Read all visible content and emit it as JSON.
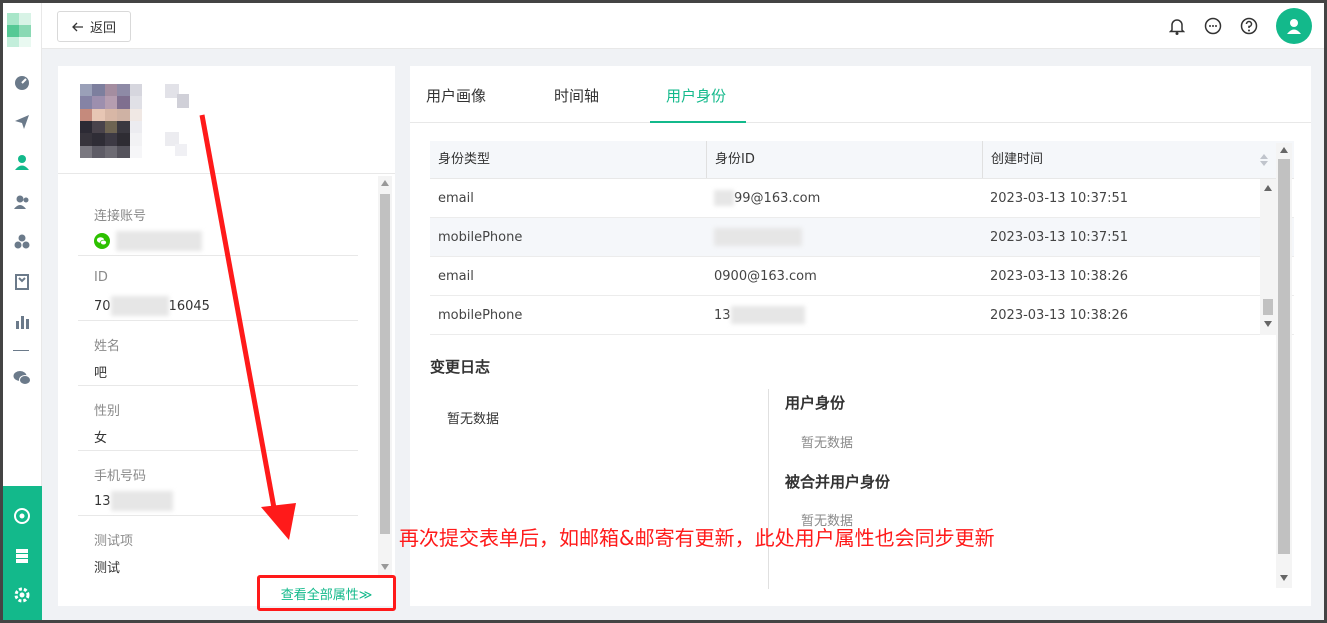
{
  "header": {
    "back_label": "返回",
    "icons": [
      "bell-icon",
      "chat-icon",
      "help-icon",
      "user-avatar-icon"
    ]
  },
  "rail": {
    "icons": [
      "dashboard-icon",
      "send-icon",
      "user-icon",
      "users-icon",
      "cluster-icon",
      "bookmark-icon",
      "bar-chart-icon",
      "wechat-icon"
    ],
    "bottom_icons": [
      "ai-icon",
      "server-icon",
      "settings-icon"
    ],
    "accent": "#13b98b"
  },
  "profile": {
    "attributes": [
      {
        "label": "连接账号",
        "value": ""
      },
      {
        "label": "ID",
        "value_prefix": "70",
        "value_suffix": "16045"
      },
      {
        "label": "姓名",
        "value": "吧"
      },
      {
        "label": "性别",
        "value": "女"
      },
      {
        "label": "手机号码",
        "value_prefix": "13"
      },
      {
        "label": "测试项",
        "value": "测试"
      }
    ],
    "view_all_label": "查看全部属性≫"
  },
  "tabs": [
    {
      "label": "用户画像",
      "active": false
    },
    {
      "label": "时间轴",
      "active": false
    },
    {
      "label": "用户身份",
      "active": true
    }
  ],
  "identity_table": {
    "columns": [
      "身份类型",
      "身份ID",
      "创建时间"
    ],
    "rows": [
      {
        "type": "email",
        "id": "99@163.com",
        "created": "2023-03-13 10:37:51"
      },
      {
        "type": "mobilePhone",
        "id": "",
        "created": "2023-03-13 10:37:51"
      },
      {
        "type": "email",
        "id": "0900@163.com",
        "created": "2023-03-13 10:38:26"
      },
      {
        "type": "mobilePhone",
        "id": "13",
        "created": "2023-03-13 10:38:26"
      }
    ]
  },
  "changelog": {
    "title": "变更日志",
    "left_empty": "暂无数据",
    "user_identity_title": "用户身份",
    "user_identity_empty": "暂无数据",
    "merged_identity_title": "被合并用户身份",
    "merged_identity_empty": "暂无数据"
  },
  "annotation": {
    "text": "再次提交表单后，如邮箱&邮寄有更新，此处用户属性也会同步更新",
    "color": "#ff1a1a"
  }
}
